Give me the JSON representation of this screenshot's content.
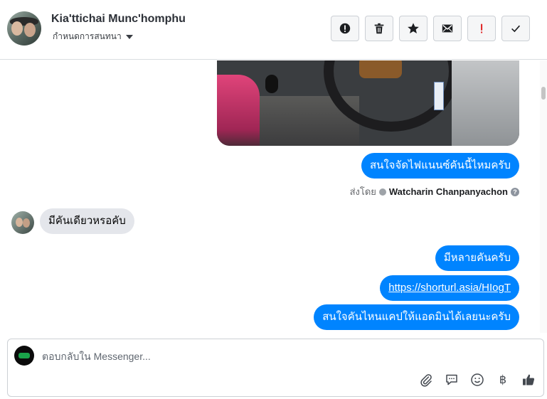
{
  "header": {
    "name": "Kia'ttichai Munc'homphu",
    "subtitle": "กำหนดการสนทนา"
  },
  "toolbar": [
    {
      "icon": "alert-circle-icon",
      "name": "report-spam-button"
    },
    {
      "icon": "trash-icon",
      "name": "delete-button"
    },
    {
      "icon": "star-icon",
      "name": "star-button"
    },
    {
      "icon": "envelope-icon",
      "name": "mark-unread-button"
    },
    {
      "icon": "exclamation-icon",
      "name": "priority-button",
      "color": "#e02020"
    },
    {
      "icon": "check-icon",
      "name": "mark-done-button"
    }
  ],
  "messages": {
    "m1": "สนใจจัดไฟแนนซ์คันนี้ไหมครับ",
    "sent_by_label": "ส่งโดย",
    "sent_by_agent": "Watcharin Chanpanyachon",
    "help_glyph": "?",
    "m2": "มีคันเดียวหรอคับ",
    "m3": "มีหลายคันครับ",
    "m4": "https://shorturl.asia/HIogT",
    "m5": "สนใจคันไหนแคปให้แอดมินได้เลยนะครับ"
  },
  "composer": {
    "placeholder": "ตอบกลับใน Messenger...",
    "tools": [
      "paperclip-icon",
      "speech-bubble-icon",
      "smiley-icon",
      "baht-icon",
      "thumbs-up-icon"
    ],
    "baht_glyph": "฿"
  },
  "colors": {
    "outgoing_bubble": "#0084ff",
    "incoming_bubble": "#e4e6eb",
    "priority_red": "#e02020"
  }
}
